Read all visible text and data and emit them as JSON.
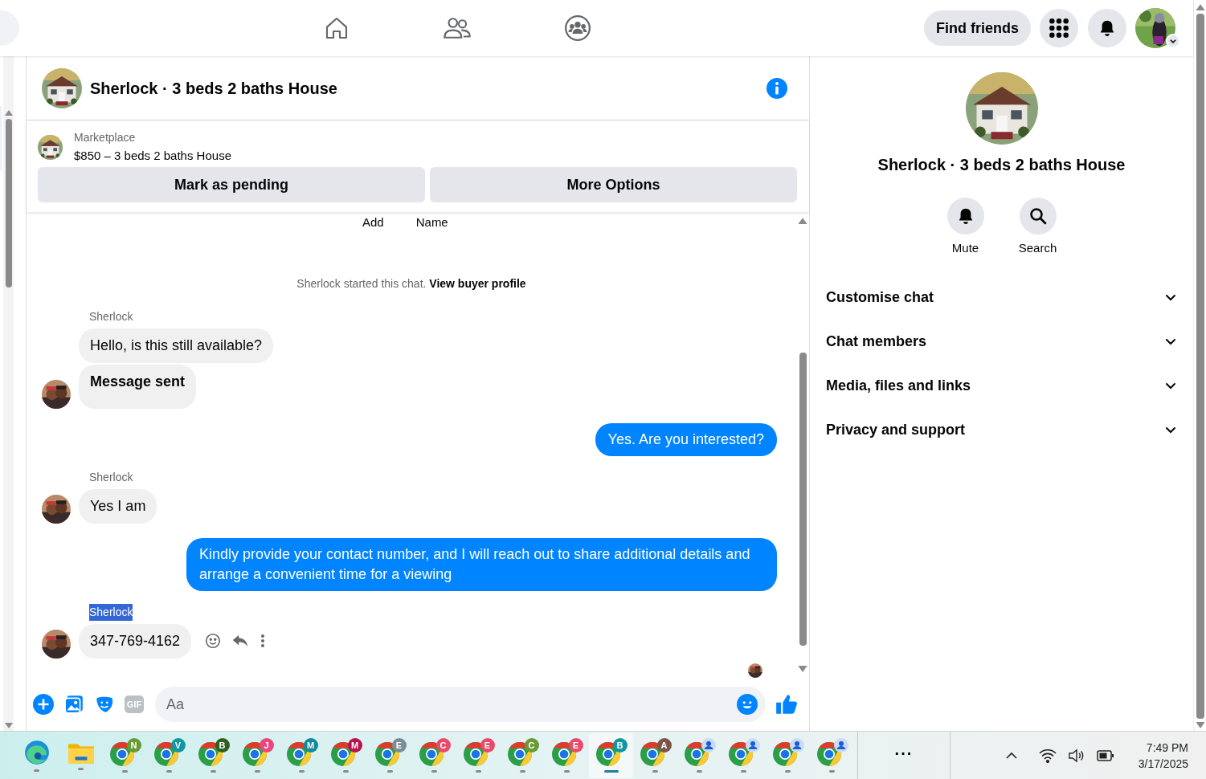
{
  "top_nav": {
    "tabs": [
      {
        "kind": "home",
        "selected": false
      },
      {
        "kind": "friends",
        "selected": false
      },
      {
        "kind": "groups",
        "selected": false
      }
    ],
    "find_friends": "Find friends"
  },
  "chat": {
    "title": "Sherlock · 3 beds 2 baths House",
    "listing": {
      "source": "Marketplace",
      "summary": "$850 – 3 beds 2 baths House",
      "buttons": [
        "Mark as pending",
        "More Options"
      ]
    },
    "header_labels": [
      "Add",
      "Name"
    ],
    "messages": [
      {
        "kind": "system",
        "text": "Sherlock started this chat.",
        "link": "View buyer profile"
      },
      {
        "kind": "incoming",
        "sender": "Sherlock",
        "sender_selected": false,
        "hovered": false,
        "bubbles": [
          {
            "text": "Hello, is this still available?",
            "bold": false
          },
          {
            "text": "Message sent",
            "bold": true
          }
        ]
      },
      {
        "kind": "outgoing",
        "bubbles": [
          {
            "text": "Yes. Are you interested?",
            "bold": false
          }
        ]
      },
      {
        "kind": "incoming",
        "sender": "Sherlock",
        "sender_selected": false,
        "hovered": false,
        "bubbles": [
          {
            "text": "Yes I am",
            "bold": false
          }
        ]
      },
      {
        "kind": "outgoing",
        "bubbles": [
          {
            "text": "Kindly provide your contact number, and I will reach out to share additional details and arrange a convenient time for a viewing",
            "bold": false
          }
        ]
      },
      {
        "kind": "incoming",
        "sender": "Sherlock",
        "sender_selected": true,
        "hovered": true,
        "bubbles": [
          {
            "text": "347-769-4162",
            "bold": false
          }
        ]
      }
    ],
    "composer": {
      "placeholder": "Aa",
      "gif": "GIF"
    }
  },
  "details": {
    "title": "Sherlock · 3 beds 2 baths House",
    "actions": [
      {
        "kind": "mute",
        "label": "Mute"
      },
      {
        "kind": "search",
        "label": "Search"
      }
    ],
    "sections": [
      {
        "label": "Customise chat",
        "expanded": false
      },
      {
        "label": "Chat members",
        "expanded": false
      },
      {
        "label": "Media, files and links",
        "expanded": false
      },
      {
        "label": "Privacy and support",
        "expanded": false
      }
    ]
  },
  "taskbar": {
    "apps": [
      {
        "kind": "edge",
        "active": false
      },
      {
        "kind": "explorer",
        "active": false
      },
      {
        "kind": "chrome",
        "badge": "N",
        "color": "#6a9a34",
        "active": false
      },
      {
        "kind": "chrome",
        "badge": "V",
        "color": "#1396a3",
        "active": false
      },
      {
        "kind": "chrome",
        "badge": "B",
        "color": "#2f5e1e",
        "active": false
      },
      {
        "kind": "chrome",
        "badge": "J",
        "color": "#e8467c",
        "active": false
      },
      {
        "kind": "chrome",
        "badge": "M",
        "color": "#138a9c",
        "active": false
      },
      {
        "kind": "chrome",
        "badge": "M",
        "color": "#b8124f",
        "active": false
      },
      {
        "kind": "chrome",
        "badge": "E",
        "color": "#7a8b99",
        "active": false
      },
      {
        "kind": "chrome",
        "badge": "C",
        "color": "#e84a6a",
        "active": false
      },
      {
        "kind": "chrome",
        "badge": "E",
        "color": "#e84a6a",
        "active": false
      },
      {
        "kind": "chrome",
        "badge": "C",
        "color": "#6a9a34",
        "active": false
      },
      {
        "kind": "chrome",
        "badge": "E",
        "color": "#e84a6a",
        "active": false
      },
      {
        "kind": "chrome",
        "badge": "B",
        "color": "#1396a3",
        "active": true
      },
      {
        "kind": "chrome",
        "badge": "A",
        "color": "#7a5548",
        "active": false
      },
      {
        "kind": "chrome-person",
        "active": false
      },
      {
        "kind": "chrome-person",
        "active": false
      },
      {
        "kind": "chrome-person",
        "active": false
      },
      {
        "kind": "chrome-person",
        "active": false
      }
    ],
    "more": "···",
    "time": "7:49 PM",
    "date": "3/17/2025"
  }
}
